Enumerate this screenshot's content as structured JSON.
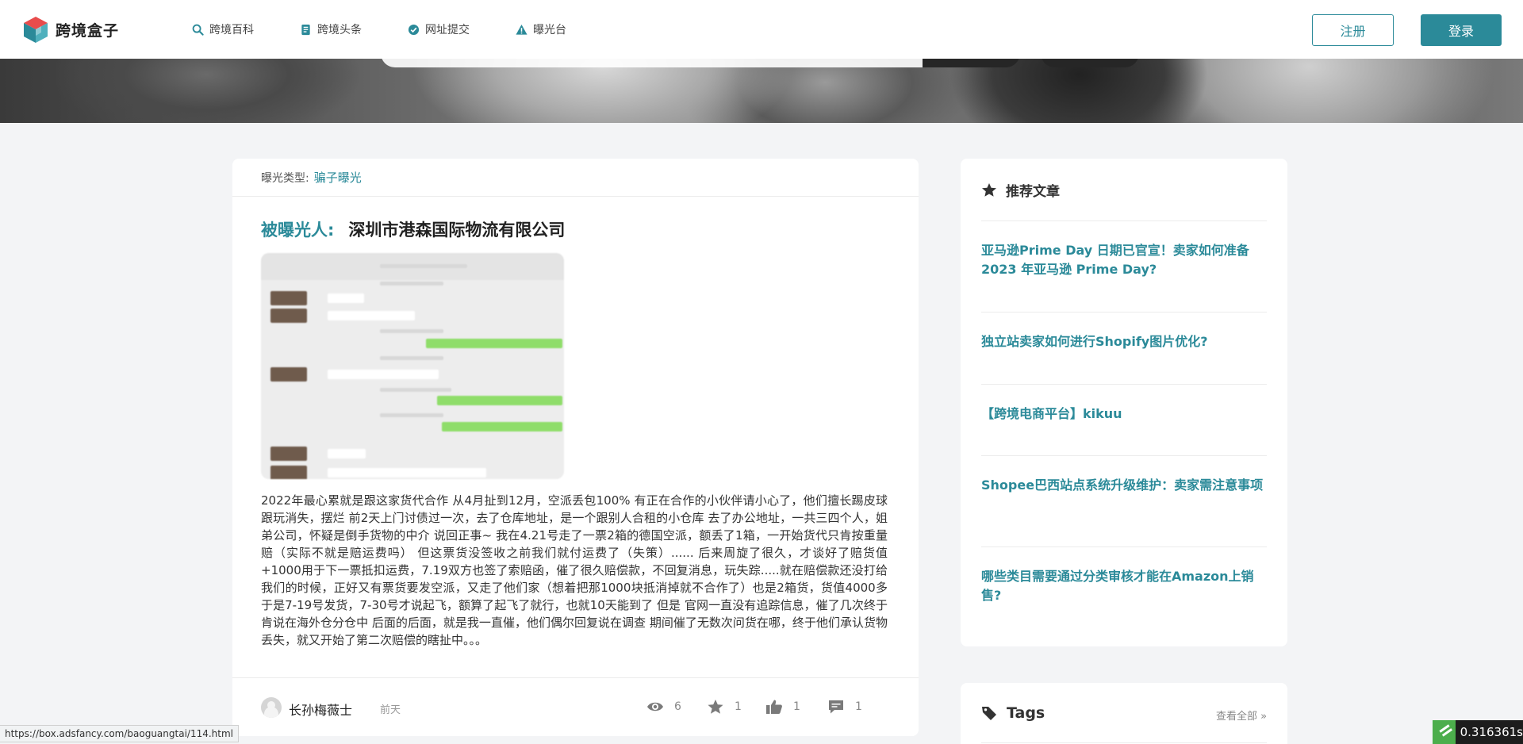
{
  "header": {
    "logo_text": "跨境盒子",
    "nav": [
      {
        "label": "跨境百科",
        "icon": "search-icon"
      },
      {
        "label": "跨境头条",
        "icon": "document-icon"
      },
      {
        "label": "网址提交",
        "icon": "check-circle-icon"
      },
      {
        "label": "曝光台",
        "icon": "warning-icon"
      }
    ],
    "register_label": "注册",
    "login_label": "登录"
  },
  "article": {
    "type_label": "曝光类型:",
    "type_value": "骗子曝光",
    "exposed_label": "被曝光人:",
    "exposed_name": "深圳市港森国际物流有限公司",
    "body": "2022年最心累就是跟这家货代合作 从4月扯到12月，空派丢包100% 有正在合作的小伙伴请小心了，他们擅长踢皮球跟玩消失，摆烂 前2天上门讨债过一次，去了仓库地址，是一个跟别人合租的小仓库 去了办公地址，一共三四个人，姐弟公司，怀疑是倒手货物的中介 说回正事~ 我在4.21号走了一票2箱的德国空派，额丢了1箱，一开始货代只肯按重量赔（实际不就是赔运费吗） 但这票货没签收之前我们就付运费了（失策）...... 后来周旋了很久，才谈好了赔货值+1000用于下一票抵扣运费，7.19双方也签了索赔函，催了很久赔偿款，不回复消息，玩失踪.....就在赔偿款还没打给我们的时候，正好又有票货要发空派，又走了他们家（想着把那1000块抵消掉就不合作了）也是2箱货，货值4000多 于是7-19号发货，7-30号才说起飞，额算了起飞了就行，也就10天能到了 但是 官网一直没有追踪信息，催了几次终于肯说在海外仓分仓中 后面的后面，就是我一直催，他们偶尔回复说在调查 期间催了无数次问货在哪，终于他们承认货物丢失，就又开始了第二次赔偿的瞎扯中。。。",
    "author": "长孙梅薇士",
    "time": "前天",
    "stats": {
      "views": "6",
      "favorites": "1",
      "likes": "1",
      "comments": "1"
    }
  },
  "sidebar": {
    "recommended_title": "推荐文章",
    "articles": [
      "亚马逊Prime Day 日期已官宣！卖家如何准备 2023 年亚马逊 Prime Day?",
      "独立站卖家如何进行Shopify图片优化?",
      "【跨境电商平台】kikuu",
      "Shopee巴西站点系统升级维护：卖家需注意事项",
      "哪些类目需要通过分类审核才能在Amazon上销售?"
    ],
    "tags_title": "Tags",
    "tags_more": "查看全部 »"
  },
  "browser": {
    "status_url": "https://box.adsfancy.com/baoguangtai/114.html",
    "timer": "0.316361s"
  },
  "colors": {
    "accent": "#2b8a99",
    "background": "#f3f4f6"
  }
}
